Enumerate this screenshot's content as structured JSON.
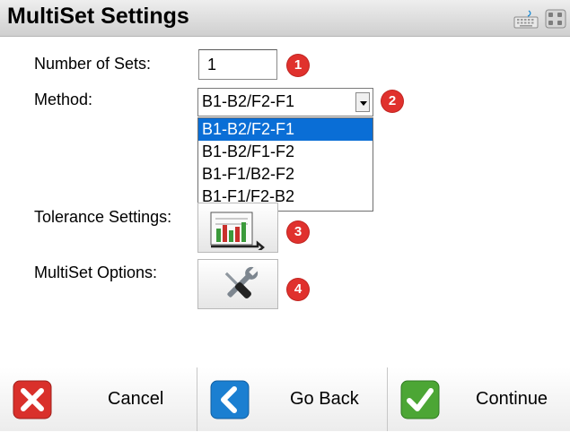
{
  "window": {
    "title": "MultiSet Settings"
  },
  "icons": {
    "keyboard": "keyboard-icon",
    "grid": "grid-icon",
    "tolerance": "bar-chart-icon",
    "options": "wrench-screwdriver-icon",
    "cancel": "red-x-icon",
    "back": "blue-chevron-left-icon",
    "continue": "green-check-icon"
  },
  "form": {
    "sets_label": "Number of Sets:",
    "sets_value": "1",
    "method_label": "Method:",
    "method_value": "B1-B2/F2-F1",
    "method_options": [
      "B1-B2/F2-F1",
      "B1-B2/F1-F2",
      "B1-F1/B2-F2",
      "B1-F1/F2-B2"
    ],
    "tolerance_label": "Tolerance Settings:",
    "options_label": "MultiSet Options:"
  },
  "badges": [
    "1",
    "2",
    "3",
    "4"
  ],
  "footer": {
    "cancel": "Cancel",
    "back": "Go Back",
    "continue": "Continue"
  },
  "colors": {
    "badge": "#e0312d",
    "selection": "#0a6ed6",
    "cancel": "#d9302b",
    "back": "#1b7fd1",
    "continue": "#4ca635"
  }
}
